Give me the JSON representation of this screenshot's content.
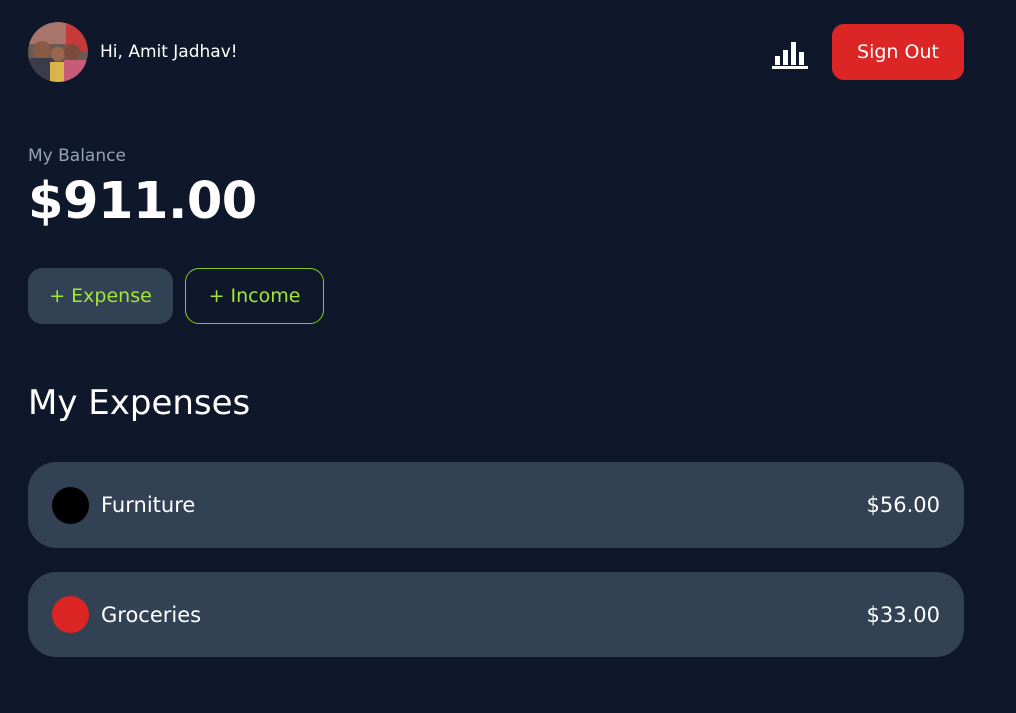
{
  "header": {
    "greeting": "Hi, Amit Jadhav!",
    "stats_icon": "bar-chart-icon",
    "signout_label": "Sign Out"
  },
  "balance": {
    "label": "My Balance",
    "value": "$911.00"
  },
  "actions": {
    "expense_label": "+ Expense",
    "income_label": "+ Income"
  },
  "expenses": {
    "title": "My Expenses",
    "items": [
      {
        "name": "Furniture",
        "amount": "$56.00",
        "color": "#000000"
      },
      {
        "name": "Groceries",
        "amount": "$33.00",
        "color": "#dc2626"
      }
    ]
  },
  "colors": {
    "background": "#0f172a",
    "card": "#334155",
    "accent_green": "#a3e635",
    "danger": "#dc2626",
    "muted": "#94a3b8"
  }
}
